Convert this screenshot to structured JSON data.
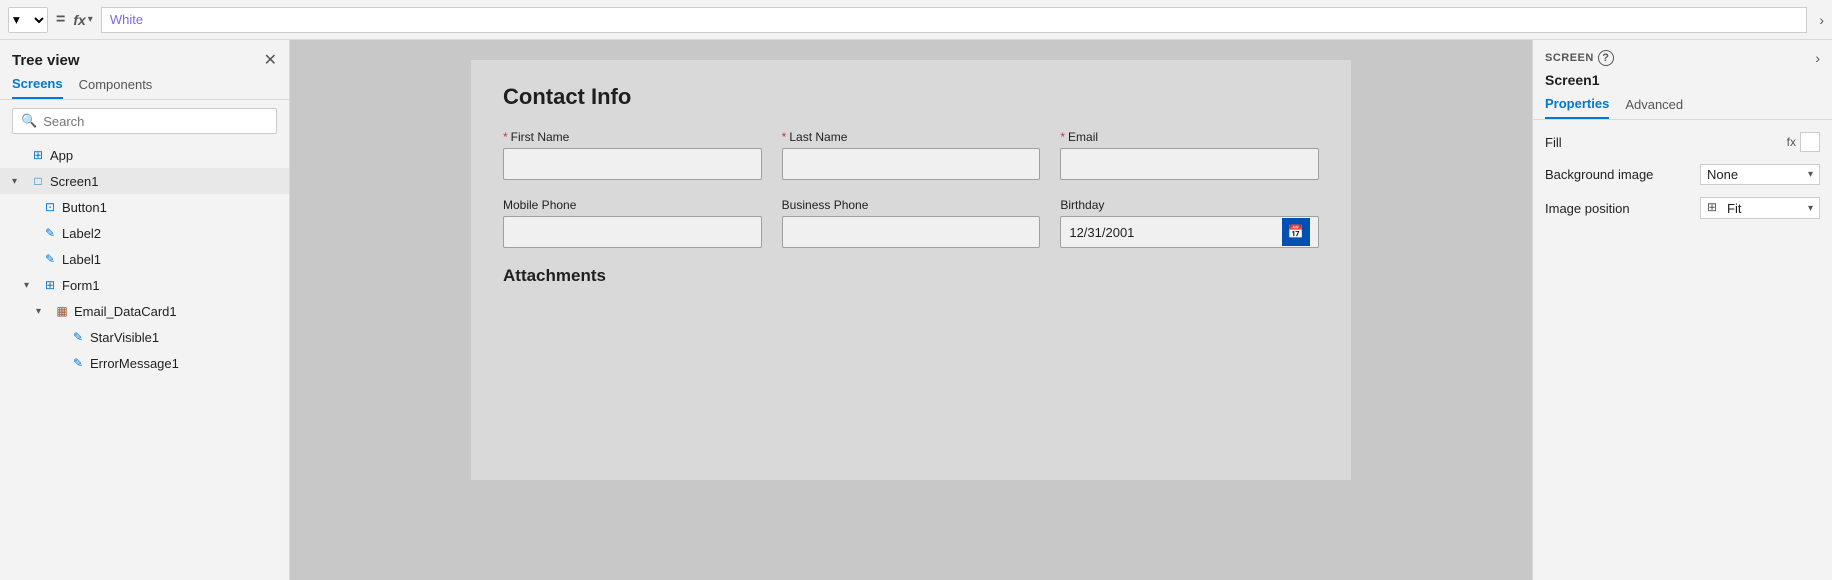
{
  "topbar": {
    "formula_value": "White",
    "fx_label": "fx",
    "equals_label": "=",
    "chevron_right": "›"
  },
  "tree_panel": {
    "title": "Tree view",
    "close_label": "✕",
    "tabs": [
      {
        "id": "screens",
        "label": "Screens",
        "active": true
      },
      {
        "id": "components",
        "label": "Components",
        "active": false
      }
    ],
    "search_placeholder": "Search",
    "items": [
      {
        "id": "app",
        "label": "App",
        "icon": "⊞",
        "icon_class": "icon-button",
        "indent": 0,
        "chevron": ""
      },
      {
        "id": "screen1",
        "label": "Screen1",
        "icon": "□",
        "icon_class": "icon-screen",
        "indent": 0,
        "chevron": "▾",
        "selected": true,
        "has_menu": true
      },
      {
        "id": "button1",
        "label": "Button1",
        "icon": "⊡",
        "icon_class": "icon-button",
        "indent": 1,
        "chevron": ""
      },
      {
        "id": "label2",
        "label": "Label2",
        "icon": "✎",
        "icon_class": "icon-label",
        "indent": 1,
        "chevron": ""
      },
      {
        "id": "label1",
        "label": "Label1",
        "icon": "✎",
        "icon_class": "icon-label",
        "indent": 1,
        "chevron": ""
      },
      {
        "id": "form1",
        "label": "Form1",
        "icon": "⊞",
        "icon_class": "icon-form",
        "indent": 1,
        "chevron": "▾"
      },
      {
        "id": "email_datacard1",
        "label": "Email_DataCard1",
        "icon": "▦",
        "icon_class": "icon-datacard",
        "indent": 2,
        "chevron": "▾"
      },
      {
        "id": "starvisible1",
        "label": "StarVisible1",
        "icon": "✎",
        "icon_class": "icon-label",
        "indent": 3,
        "chevron": ""
      },
      {
        "id": "errormessage1",
        "label": "ErrorMessage1",
        "icon": "✎",
        "icon_class": "icon-label",
        "indent": 3,
        "chevron": ""
      }
    ]
  },
  "canvas": {
    "form_title": "Contact Info",
    "rows": [
      {
        "fields": [
          {
            "id": "first_name",
            "label": "First Name",
            "required": true,
            "value": "",
            "placeholder": ""
          },
          {
            "id": "last_name",
            "label": "Last Name",
            "required": true,
            "value": "",
            "placeholder": ""
          },
          {
            "id": "email",
            "label": "Email",
            "required": true,
            "value": "",
            "placeholder": ""
          }
        ]
      },
      {
        "fields": [
          {
            "id": "mobile_phone",
            "label": "Mobile Phone",
            "required": false,
            "value": "",
            "placeholder": ""
          },
          {
            "id": "business_phone",
            "label": "Business Phone",
            "required": false,
            "value": "",
            "placeholder": ""
          },
          {
            "id": "birthday",
            "label": "Birthday",
            "required": false,
            "value": "12/31/2001",
            "placeholder": "",
            "is_date": true
          }
        ]
      }
    ],
    "attachments_label": "Attachments"
  },
  "right_panel": {
    "screen_section_label": "SCREEN",
    "help_icon": "?",
    "screen_name": "Screen1",
    "chevron_right": "›",
    "tabs": [
      {
        "id": "properties",
        "label": "Properties",
        "active": true
      },
      {
        "id": "advanced",
        "label": "Advanced",
        "active": false
      }
    ],
    "properties": {
      "fill_label": "Fill",
      "fill_fx": "fx",
      "background_image_label": "Background image",
      "background_image_value": "None",
      "image_position_label": "Image position",
      "image_position_icon": "⊞",
      "image_position_value": "Fit"
    }
  }
}
